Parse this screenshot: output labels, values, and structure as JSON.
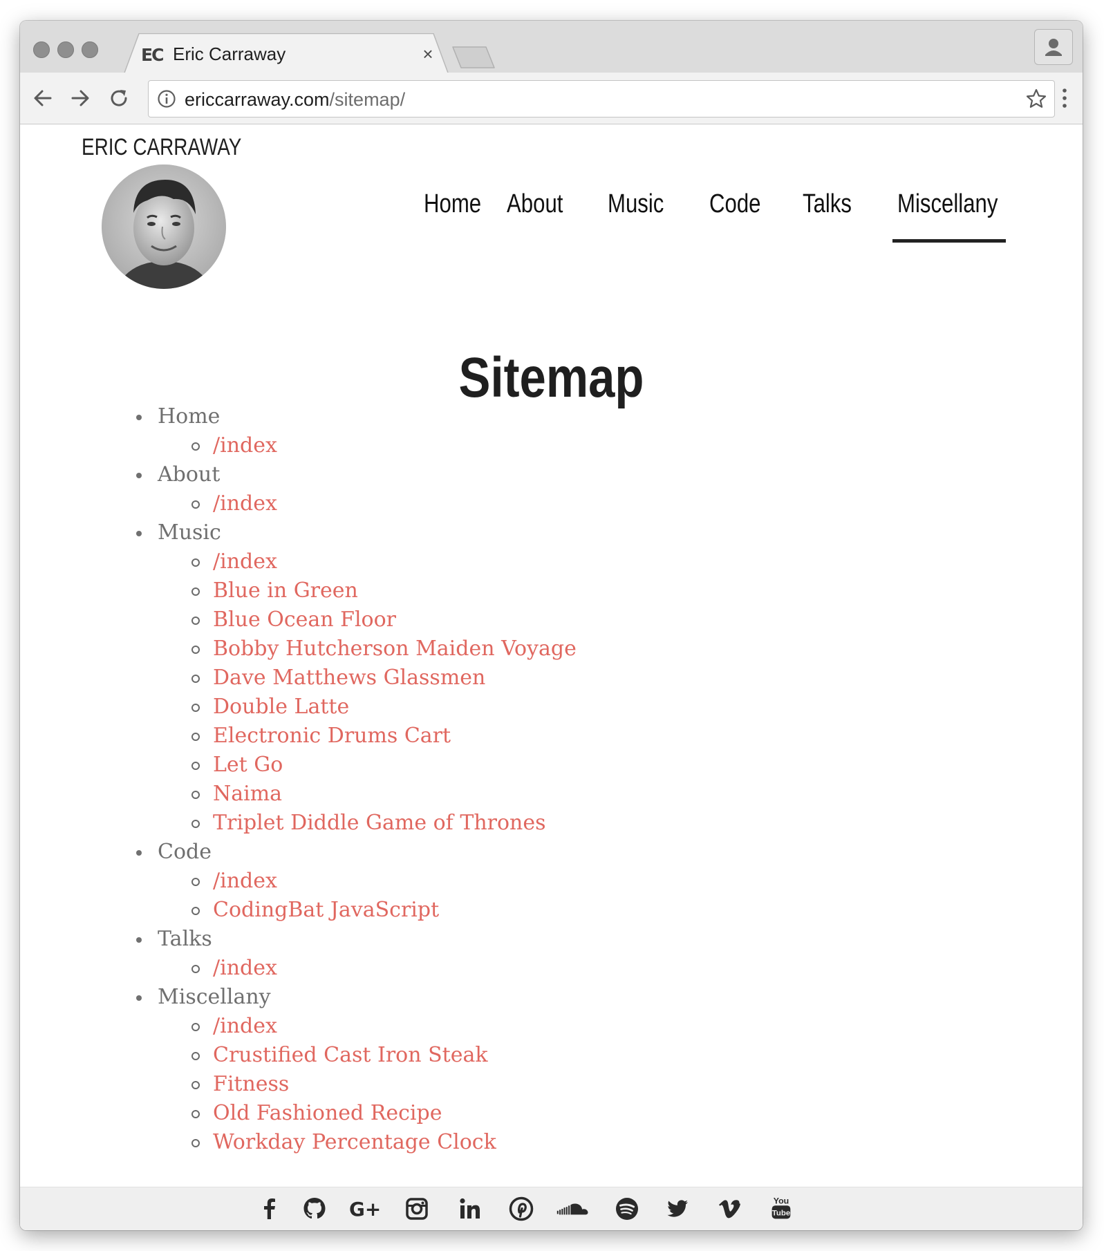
{
  "browser": {
    "tab": {
      "favicon_text": "EC",
      "title": "Eric Carraway",
      "close_symbol": "×"
    },
    "url": {
      "domain": "ericcarraway.com",
      "path": "/sitemap/"
    }
  },
  "site": {
    "title": "ERIC CARRAWAY",
    "nav": [
      {
        "label": "Home"
      },
      {
        "label": "About"
      },
      {
        "label": "Music"
      },
      {
        "label": "Code"
      },
      {
        "label": "Talks"
      },
      {
        "label": "Miscellany",
        "active": true
      }
    ]
  },
  "page": {
    "title": "Sitemap",
    "sections": [
      {
        "label": "Home",
        "links": [
          "/index"
        ]
      },
      {
        "label": "About",
        "links": [
          "/index"
        ]
      },
      {
        "label": "Music",
        "links": [
          "/index",
          "Blue in Green",
          "Blue Ocean Floor",
          "Bobby Hutcherson Maiden Voyage",
          "Dave Matthews Glassmen",
          "Double Latte",
          "Electronic Drums Cart",
          "Let Go",
          "Naima",
          "Triplet Diddle Game of Thrones"
        ]
      },
      {
        "label": "Code",
        "links": [
          "/index",
          "CodingBat JavaScript"
        ]
      },
      {
        "label": "Talks",
        "links": [
          "/index"
        ]
      },
      {
        "label": "Miscellany",
        "links": [
          "/index",
          "Crustified Cast Iron Steak",
          "Fitness",
          "Old Fashioned Recipe",
          "Workday Percentage Clock"
        ]
      }
    ]
  },
  "footer": {
    "social": [
      "facebook-icon",
      "github-icon",
      "google-plus-icon",
      "instagram-icon",
      "linkedin-icon",
      "pinterest-icon",
      "soundcloud-icon",
      "spotify-icon",
      "twitter-icon",
      "vimeo-icon",
      "youtube-icon"
    ],
    "youtube_logo_text": [
      "You",
      "Tube"
    ]
  },
  "colors": {
    "link": "#e0675f",
    "section_label": "#6f6f6f",
    "nav_text": "#111111",
    "footer_bg": "#efefef"
  }
}
